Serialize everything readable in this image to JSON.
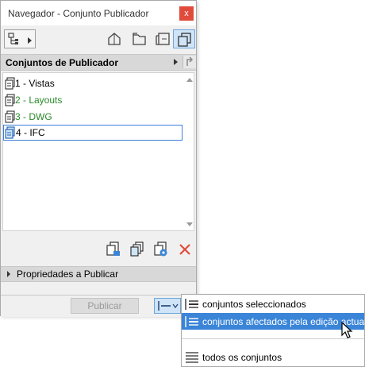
{
  "window": {
    "title": "Navegador - Conjunto Publicador",
    "close_label": "x"
  },
  "toolbar": {
    "buttons": [
      {
        "icon": "project-tree-icon"
      },
      {
        "icon": "view-map-icon"
      },
      {
        "icon": "layout-book-icon"
      },
      {
        "icon": "layout-sheet-icon"
      },
      {
        "icon": "publisher-sets-icon",
        "active": true
      }
    ]
  },
  "section": {
    "label": "Conjuntos de Publicador"
  },
  "sets": [
    {
      "label": "1 - Vistas",
      "color": "#000000"
    },
    {
      "label": "2 - Layouts",
      "color": "#2a8a2a"
    },
    {
      "label": "3 - DWG",
      "color": "#2a8a2a"
    },
    {
      "label": "4 - IFC",
      "color": "#000000",
      "selected": true
    }
  ],
  "bottom_tools": [
    {
      "icon": "new-set-icon"
    },
    {
      "icon": "duplicate-set-icon"
    },
    {
      "icon": "publish-settings-icon"
    },
    {
      "icon": "delete-icon",
      "color": "#e04b3c"
    }
  ],
  "properties": {
    "label": "Propriedades a Publicar"
  },
  "footer": {
    "publish_label": "Publicar"
  },
  "dropdown": {
    "items": [
      {
        "label": "conjuntos seleccionados",
        "icon": "selected-sets-icon"
      },
      {
        "label": "conjuntos afectados pela edição actual",
        "icon": "affected-sets-icon",
        "highlighted": true
      },
      {
        "label": "todos os conjuntos",
        "icon": "all-sets-icon"
      }
    ]
  },
  "colors": {
    "accent": "#3a85d8",
    "close": "#e04b3c",
    "green_text": "#2a8a2a"
  }
}
